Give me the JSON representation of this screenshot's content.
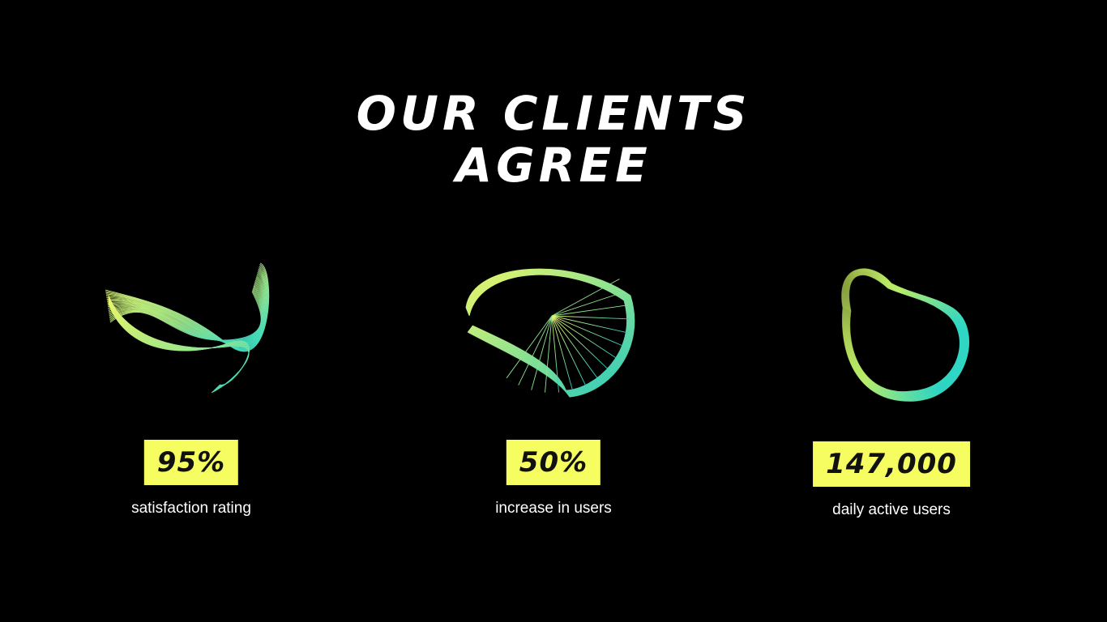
{
  "heading": {
    "line1": "OUR CLIENTS",
    "line2": "AGREE"
  },
  "colors": {
    "background": "#000000",
    "badge": "#f5fd61",
    "gradient_yellow": "#e9f56a",
    "gradient_teal": "#2fd6c4"
  },
  "stats": [
    {
      "value": "95%",
      "label": "satisfaction rating",
      "graphic": "wireframe-ribbon-icon"
    },
    {
      "value": "50%",
      "label": "increase in users",
      "graphic": "wireframe-shell-icon"
    },
    {
      "value": "147,000",
      "label": "daily active users",
      "graphic": "wireframe-ring-icon"
    }
  ]
}
